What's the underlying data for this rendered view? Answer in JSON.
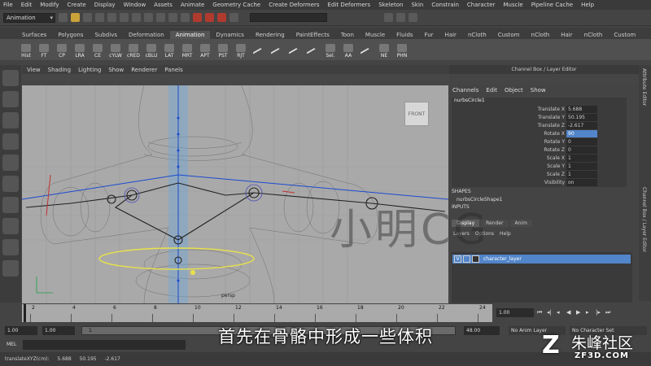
{
  "menubar": [
    "File",
    "Edit",
    "Modify",
    "Create",
    "Display",
    "Window",
    "Assets",
    "Animate",
    "Geometry Cache",
    "Create Deformers",
    "Edit Deformers",
    "Skeleton",
    "Skin",
    "Constrain",
    "Character",
    "Muscle",
    "Pipeline Cache",
    "Help"
  ],
  "status": {
    "mode": "Animation"
  },
  "shelf_tabs": [
    "Surfaces",
    "Polygons",
    "Subdivs",
    "Deformation",
    "Animation",
    "Dynamics",
    "Rendering",
    "PaintEffects",
    "Toon",
    "Muscle",
    "Fluids",
    "Fur",
    "Hair",
    "nCloth",
    "Custom",
    "nCloth",
    "Hair",
    "nCloth",
    "Custom"
  ],
  "shelf_tools": [
    "Hist",
    "FT",
    "CP",
    "LRA",
    "CE",
    "cYLW",
    "cRED",
    "cBLU",
    "LAT",
    "MRT",
    "APT",
    "PST",
    "RJT",
    "",
    "",
    "",
    "",
    "Sel.",
    "AA",
    "",
    "NE",
    "PHN"
  ],
  "panel_menu": [
    "View",
    "Shading",
    "Lighting",
    "Show",
    "Renderer",
    "Panels"
  ],
  "viewport": {
    "camera": "persp",
    "viewcube": "FRONT"
  },
  "channel_box": {
    "header": "Channel Box / Layer Editor",
    "menu": [
      "Channels",
      "Edit",
      "Object",
      "Show"
    ],
    "object": "nurbsCircle1",
    "attributes": [
      {
        "label": "Translate X",
        "value": "5.688"
      },
      {
        "label": "Translate Y",
        "value": "50.195"
      },
      {
        "label": "Translate Z",
        "value": "-2.617"
      },
      {
        "label": "Rotate X",
        "value": "90"
      },
      {
        "label": "Rotate Y",
        "value": "0"
      },
      {
        "label": "Rotate Z",
        "value": "0"
      },
      {
        "label": "Scale X",
        "value": "1"
      },
      {
        "label": "Scale Y",
        "value": "1"
      },
      {
        "label": "Scale Z",
        "value": "1"
      },
      {
        "label": "Visibility",
        "value": "on"
      }
    ],
    "shapes_title": "SHAPES",
    "shape": "nurbsCircleShape1",
    "inputs_title": "INPUTS"
  },
  "layer_editor": {
    "tabs": [
      "Display",
      "Render",
      "Anim"
    ],
    "menu": [
      "Layers",
      "Options",
      "Help"
    ],
    "row": {
      "v": "V",
      "name": "character_layer"
    }
  },
  "side_tabs": [
    "Attribute Editor",
    "Channel Box / Layer Editor"
  ],
  "timeline": {
    "ticks": [
      "2",
      "4",
      "6",
      "8",
      "10",
      "12",
      "14",
      "16",
      "18",
      "20",
      "22",
      "24"
    ],
    "current": "1.00"
  },
  "range": {
    "start": "1.00",
    "start2": "1.00",
    "frame": "1",
    "end": "48.00",
    "anim_layer": "No Anim Layer",
    "char_set": "No Character Set"
  },
  "command": {
    "label": "MEL"
  },
  "help_line": {
    "label": "translateXYZ(cm):",
    "x": "5.688",
    "y": "50.195",
    "z": "-2.617"
  },
  "subtitle": "首先在骨骼中形成一些体积",
  "watermark": "小明CG",
  "logo": {
    "mark": "Z",
    "site": "朱峰社区",
    "url": "ZF3D.COM"
  },
  "colors": {
    "accent": "#5285c9",
    "viewport": "#a9a9a9",
    "joint_blue": "#1a4ad0",
    "ctrl_yellow": "#e8e14a"
  }
}
